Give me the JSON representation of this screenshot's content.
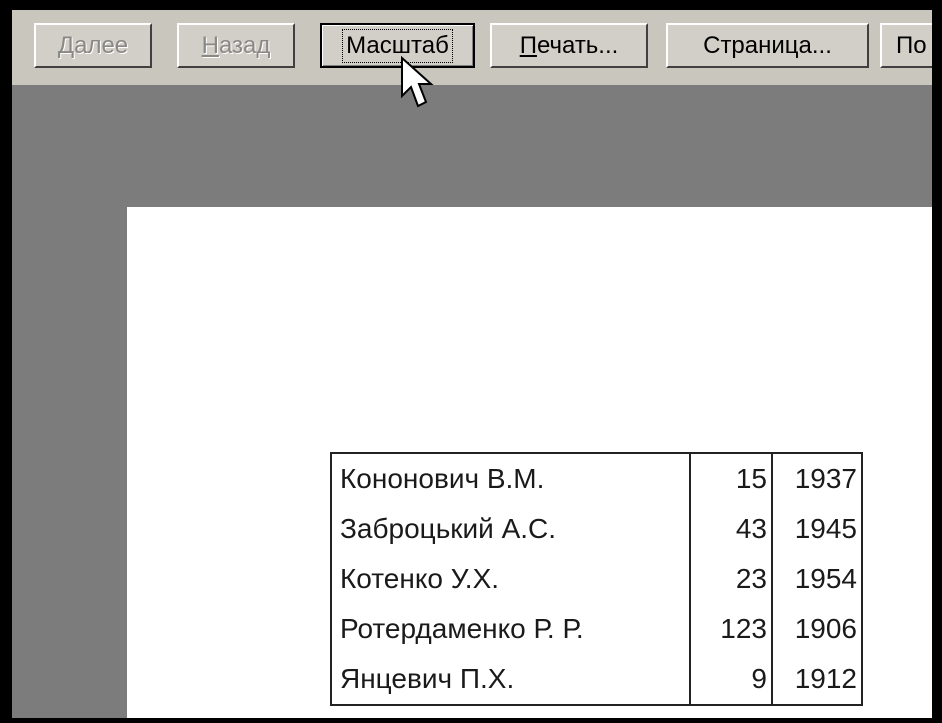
{
  "toolbar": {
    "next": {
      "mnemonic": "Д",
      "rest": "алее"
    },
    "back": {
      "mnemonic": "Н",
      "rest": "азад"
    },
    "zoom": {
      "label": "Масштаб"
    },
    "print": {
      "mnemonic": "П",
      "rest": "ечать..."
    },
    "page_setup": {
      "label": "Страница..."
    },
    "cut_button": {
      "label": "По"
    }
  },
  "table": {
    "rows": [
      {
        "name": "Кононович В.М.",
        "num": "15",
        "year": "1937"
      },
      {
        "name": "Заброцький А.С.",
        "num": "43",
        "year": "1945"
      },
      {
        "name": "Котенко У.Х.",
        "num": "23",
        "year": "1954"
      },
      {
        "name": "Ротердаменко Р. Р.",
        "num": "123",
        "year": "1906"
      },
      {
        "name": "Янцевич П.Х.",
        "num": "9",
        "year": "1912"
      }
    ]
  }
}
